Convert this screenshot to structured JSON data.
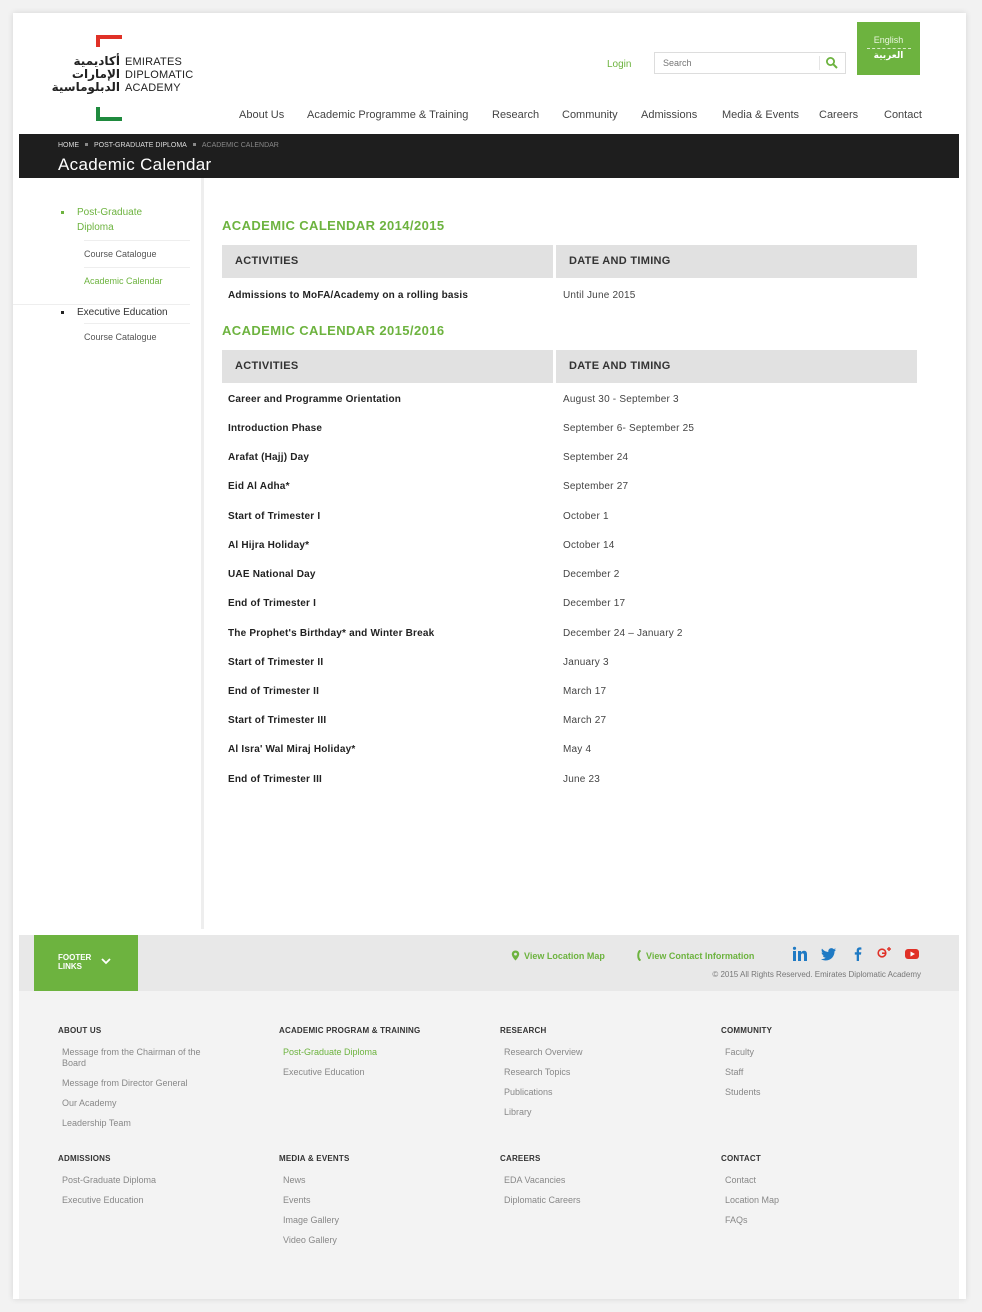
{
  "brand": {
    "arabic_lines": [
      "أكاديمية",
      "الإمارات",
      "الدبلوماسية"
    ],
    "english_lines": [
      "EMIRATES",
      "DIPLOMATIC",
      "ACADEMY"
    ],
    "color_red": "#e03127",
    "color_green": "#1f8a3e"
  },
  "header": {
    "login_label": "Login",
    "search_placeholder": "Search",
    "lang_english": "English",
    "lang_arabic": "العربية",
    "accent_color": "#6db33f"
  },
  "nav": {
    "items": [
      "About Us",
      "Academic Programme & Training",
      "Research",
      "Community",
      "Admissions",
      "Media & Events",
      "Careers",
      "Contact"
    ]
  },
  "titlebar": {
    "breadcrumb": [
      "HOME",
      "POST-GRADUATE DIPLOMA",
      "ACADEMIC CALENDAR"
    ],
    "title": "Academic Calendar"
  },
  "sidebar": {
    "section1_label": "Post-Graduate Diploma",
    "section1_sub": [
      "Course Catalogue",
      "Academic Calendar"
    ],
    "section2_label": "Executive Education",
    "section2_sub": [
      "Course Catalogue"
    ]
  },
  "calendar": {
    "col_activities": "ACTIVITIES",
    "col_date": "DATE AND TIMING",
    "cal1": {
      "title": "ACADEMIC CALENDAR 2014/2015",
      "rows": [
        {
          "activity": "Admissions to MoFA/Academy on a rolling basis",
          "date": "Until June 2015"
        }
      ]
    },
    "cal2": {
      "title": "ACADEMIC CALENDAR 2015/2016",
      "rows": [
        {
          "activity": "Career and Programme Orientation",
          "date": "August 30 - September 3"
        },
        {
          "activity": "Introduction Phase",
          "date": "September 6- September 25"
        },
        {
          "activity": "Arafat (Hajj) Day",
          "date": "September 24"
        },
        {
          "activity": "Eid Al Adha*",
          "date": "September 27"
        },
        {
          "activity": "Start of Trimester I",
          "date": "October 1"
        },
        {
          "activity": "Al Hijra Holiday*",
          "date": "October 14"
        },
        {
          "activity": "UAE National Day",
          "date": "December 2"
        },
        {
          "activity": "End of Trimester I",
          "date": "December 17"
        },
        {
          "activity": "The Prophet's Birthday* and Winter Break",
          "date": "December 24 – January 2"
        },
        {
          "activity": "Start of Trimester II",
          "date": "January 3"
        },
        {
          "activity": "End of Trimester II",
          "date": "March 17"
        },
        {
          "activity": "Start of Trimester III",
          "date": "March 27"
        },
        {
          "activity": "Al Isra' Wal Miraj Holiday*",
          "date": "May 4"
        },
        {
          "activity": "End of Trimester III",
          "date": "June 23"
        }
      ]
    }
  },
  "footbar": {
    "footer_links_line1": "FOOTER",
    "footer_links_line2": "LINKS",
    "location_map": "View Location Map",
    "contact_info": "View Contact Information",
    "copyright": "© 2015 All Rights Reserved. Emirates Diplomatic Academy",
    "social_icons": [
      "linkedin-icon",
      "twitter-icon",
      "facebook-icon",
      "google-plus-icon",
      "youtube-icon"
    ]
  },
  "footer": {
    "columns": [
      {
        "heading": "ABOUT US",
        "links": [
          "Message from the Chairman of the Board",
          "Message from Director General",
          "Our Academy",
          "Leadership Team"
        ]
      },
      {
        "heading": "ACADEMIC PROGRAM & TRAINING",
        "links": [
          "Post-Graduate Diploma",
          "Executive Education"
        ]
      },
      {
        "heading": "RESEARCH",
        "links": [
          "Research Overview",
          "Research Topics",
          "Publications",
          "Library"
        ]
      },
      {
        "heading": "COMMUNITY",
        "links": [
          "Faculty",
          "Staff",
          "Students"
        ]
      },
      {
        "heading": "ADMISSIONS",
        "links": [
          "Post-Graduate Diploma",
          "Executive Education"
        ]
      },
      {
        "heading": "MEDIA & EVENTS",
        "links": [
          "News",
          "Events",
          "Image Gallery",
          "Video Gallery"
        ]
      },
      {
        "heading": "CAREERS",
        "links": [
          "EDA Vacancies",
          "Diplomatic Careers"
        ]
      },
      {
        "heading": "CONTACT",
        "links": [
          "Contact",
          "Location Map",
          "FAQs"
        ]
      }
    ]
  }
}
